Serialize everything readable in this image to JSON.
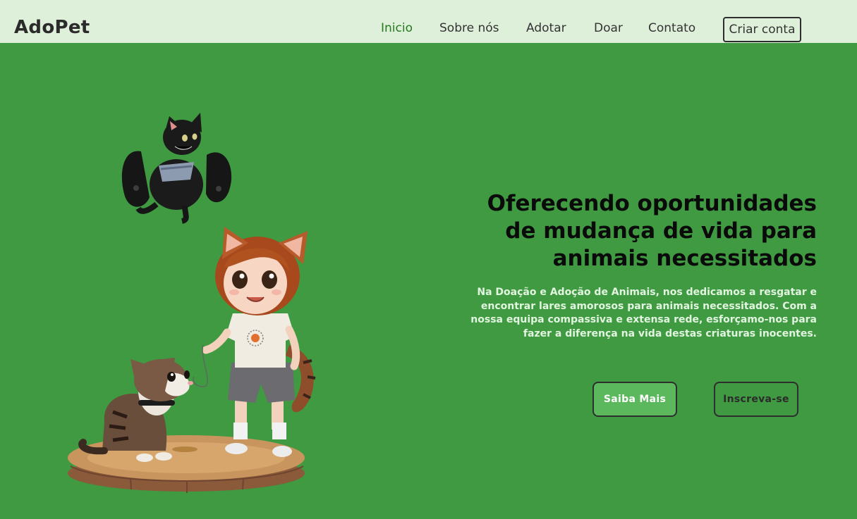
{
  "app": {
    "logo": "AdoPet"
  },
  "nav": {
    "items": [
      {
        "label": "Inicio",
        "active": true
      },
      {
        "label": "Sobre nós"
      },
      {
        "label": "Adotar"
      },
      {
        "label": "Doar"
      },
      {
        "label": "Contato"
      }
    ],
    "signup_label": "Criar conta"
  },
  "hero": {
    "title": "Oferecendo oportunidades de mudança de vida para animais necessitados",
    "text": "Na Doação e Adoção de Animais, nos dedicamos a resgatar e encontrar lares amorosos para animais necessitados. Com a nossa equipa compassiva e extensa rede, esforçamo-nos para fazer a diferença na vida destas criaturas inocentes.",
    "primary_button": "Saiba Mais",
    "secondary_button": "Inscreva-se"
  },
  "colors": {
    "header_bg": "#dff0da",
    "hero_bg": "#3f9a41",
    "active_link": "#237a1e",
    "primary_button": "#5cb85c"
  }
}
